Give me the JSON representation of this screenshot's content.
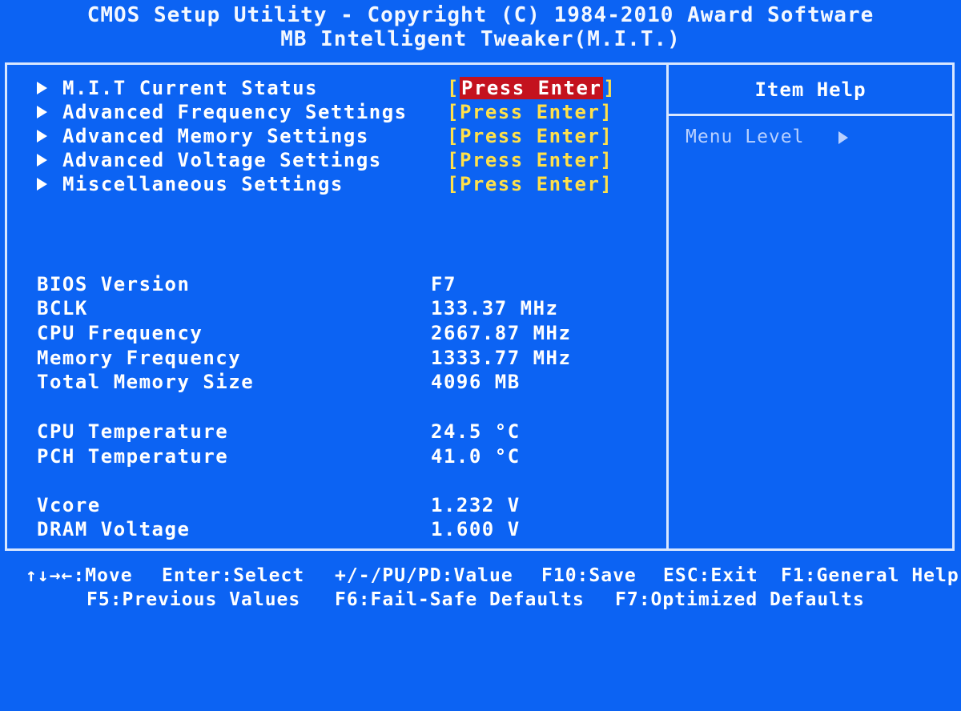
{
  "header": {
    "title": "CMOS Setup Utility - Copyright (C) 1984-2010 Award Software",
    "subtitle": "MB Intelligent Tweaker(M.I.T.)"
  },
  "menu": {
    "items": [
      {
        "label": "M.I.T Current Status",
        "value": "[Press Enter]",
        "selected": true
      },
      {
        "label": "Advanced Frequency Settings",
        "value": "[Press Enter]"
      },
      {
        "label": "Advanced Memory Settings",
        "value": "[Press Enter]"
      },
      {
        "label": "Advanced Voltage Settings",
        "value": "[Press Enter]"
      },
      {
        "label": "Miscellaneous Settings",
        "value": "[Press Enter]"
      }
    ]
  },
  "info": {
    "bios_version": {
      "label": "BIOS Version",
      "value": "F7"
    },
    "bclk": {
      "label": "BCLK",
      "value": "133.37 MHz"
    },
    "cpu_freq": {
      "label": "CPU Frequency",
      "value": "2667.87 MHz"
    },
    "mem_freq": {
      "label": "Memory Frequency",
      "value": "1333.77 MHz"
    },
    "mem_size": {
      "label": "Total Memory Size",
      "value": "4096 MB"
    },
    "cpu_temp": {
      "label": "CPU Temperature",
      "value": "24.5 °C"
    },
    "pch_temp": {
      "label": "PCH Temperature",
      "value": "41.0 °C"
    },
    "vcore": {
      "label": "Vcore",
      "value": "1.232 V"
    },
    "dram_voltage": {
      "label": "DRAM Voltage",
      "value": "1.600 V"
    }
  },
  "help": {
    "title": "Item Help",
    "menu_level": "Menu Level"
  },
  "footer": {
    "move": "↑↓→←:Move",
    "enter": "Enter:Select",
    "value": "+/-/PU/PD:Value",
    "save": "F10:Save",
    "exit": "ESC:Exit",
    "general_help": "F1:General Help",
    "previous": "F5:Previous Values",
    "failsafe": "F6:Fail-Safe Defaults",
    "optimized": "F7:Optimized Defaults"
  },
  "colors": {
    "background": "#0c63f3",
    "highlight": "#c4121e",
    "value_text": "#ffe14a",
    "border": "#d8e6ff"
  },
  "icons": {
    "menu_arrow": "triangle-right-icon",
    "menu_level_arrow": "triangle-right-icon"
  }
}
